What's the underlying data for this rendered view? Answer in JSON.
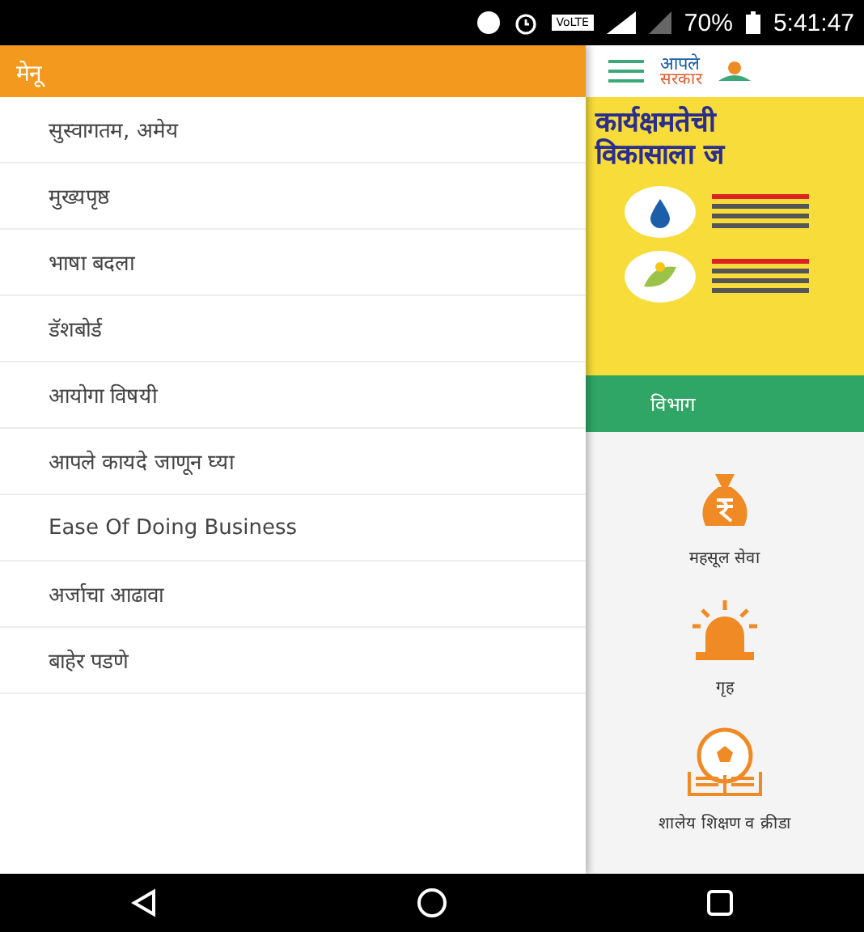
{
  "status_bar": {
    "network": "VoLTE",
    "battery": "70%",
    "time": "5:41:47"
  },
  "drawer": {
    "title": "मेनू",
    "items": [
      {
        "label": "सुस्वागतम, अमेय"
      },
      {
        "label": "मुख्यपृष्ठ"
      },
      {
        "label": "भाषा बदला"
      },
      {
        "label": "डॅशबोर्ड"
      },
      {
        "label": "आयोगा विषयी"
      },
      {
        "label": "आपले कायदे जाणून घ्या"
      },
      {
        "label": "Ease Of Doing Business"
      },
      {
        "label": "अर्जाचा आढावा"
      },
      {
        "label": "बाहेर पडणे"
      }
    ]
  },
  "app_bar": {
    "logo_top": "आपले",
    "logo_bottom": "सरकार"
  },
  "banner": {
    "headline": [
      "कार्यक्षमतेची",
      "विकासाला ज"
    ]
  },
  "tabs": [
    {
      "label": "विभाग",
      "selected": true
    }
  ],
  "categories": [
    {
      "kind": "money",
      "label": "महसूल सेवा"
    },
    {
      "kind": "siren",
      "label": "गृह"
    },
    {
      "kind": "ball",
      "label": "शालेय शिक्षण व क्रीडा"
    }
  ]
}
